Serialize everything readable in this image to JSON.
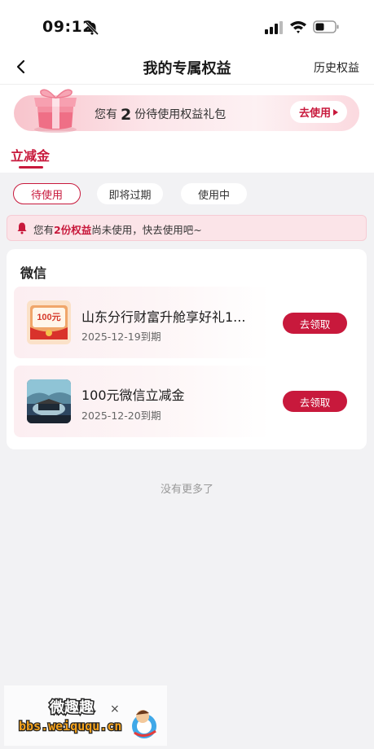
{
  "status_bar": {
    "time": "09:12"
  },
  "nav": {
    "title": "我的专属权益",
    "history_link": "历史权益"
  },
  "banner": {
    "prefix": "您有",
    "count": "2",
    "suffix": "份待使用权益礼包",
    "button_label": "去使用"
  },
  "category_tab": "立减金",
  "filters": [
    {
      "label": "待使用",
      "active": true
    },
    {
      "label": "即将过期",
      "active": false
    },
    {
      "label": "使用中",
      "active": false
    }
  ],
  "notice": {
    "prefix": "您有",
    "highlight": "2份权益",
    "suffix": "尚未使用，快去使用吧~"
  },
  "section": {
    "title": "微信",
    "items": [
      {
        "title": "山东分行财富升舱享好礼1...",
        "date": "2025-12-19到期",
        "button_label": "去领取",
        "thumb_text": "100元"
      },
      {
        "title": "100元微信立减金",
        "date": "2025-12-20到期",
        "button_label": "去领取"
      }
    ]
  },
  "footer_text": "没有更多了",
  "watermark": {
    "line1": "微趣趣",
    "line2": "bbs.weiququ.cn"
  },
  "colors": {
    "accent": "#c8193c",
    "background": "#f2f2f4",
    "notice_bg": "#fbe4e8"
  }
}
